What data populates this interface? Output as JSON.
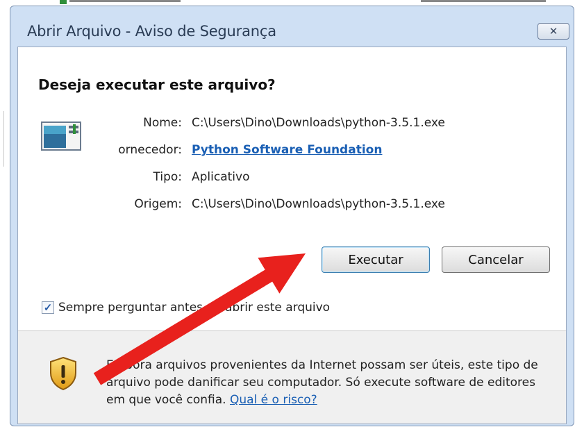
{
  "dialog": {
    "title": "Abrir Arquivo - Aviso de Segurança",
    "close_glyph": "✕",
    "question": "Deseja executar este arquivo?",
    "fields": [
      {
        "label": "Nome:",
        "value": "C:\\Users\\Dino\\Downloads\\python-3.5.1.exe",
        "link": false
      },
      {
        "label": "ornecedor:",
        "value": "Python Software Foundation",
        "link": true
      },
      {
        "label": "Tipo:",
        "value": "Aplicativo",
        "link": false
      },
      {
        "label": "Origem:",
        "value": "C:\\Users\\Dino\\Downloads\\python-3.5.1.exe",
        "link": false
      }
    ],
    "buttons": {
      "run": "Executar",
      "cancel": "Cancelar"
    },
    "checkbox": {
      "checked": true,
      "label": "Sempre perguntar antes de abrir este arquivo"
    },
    "warning": {
      "text": "Embora arquivos provenientes da Internet possam ser úteis, este tipo de arquivo pode danificar seu computador. Só execute software de editores em que você confia. ",
      "risk_link": "Qual é o risco?"
    },
    "icons": {
      "app": "application-window-icon",
      "warning": "security-shield-icon",
      "annotation": "red-arrow"
    },
    "colors": {
      "arrow": "#e8211d",
      "link": "#1a5fb4",
      "frame": "#cfe0f4"
    }
  }
}
